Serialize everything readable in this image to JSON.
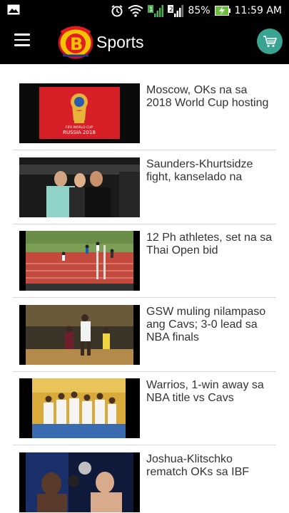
{
  "status_bar": {
    "battery": "85%",
    "time": "11:59 AM",
    "sim1": "1",
    "sim2": "2"
  },
  "app_bar": {
    "title": "Sports",
    "menu_icon": "hamburger-menu-icon",
    "cart_icon": "shopping-cart-icon",
    "accent_color": "#3aa392"
  },
  "thumb_texts": {
    "worldcup": "FIFA WORLD CUP",
    "russia": "RUSSIA 2018"
  },
  "articles": [
    {
      "title": "Moscow, OKs na sa 2018 World Cup hosting"
    },
    {
      "title": "Saunders-Khurtsidze fight, kanselado na"
    },
    {
      "title": "12 Ph athletes, set na sa Thai Open bid"
    },
    {
      "title": "GSW muling nilampaso ang Cavs; 3-0 lead sa NBA finals"
    },
    {
      "title": "Warrios, 1-win away sa NBA title vs Cavs"
    },
    {
      "title": "Joshua-Klitschko rematch OKs sa IBF"
    }
  ]
}
